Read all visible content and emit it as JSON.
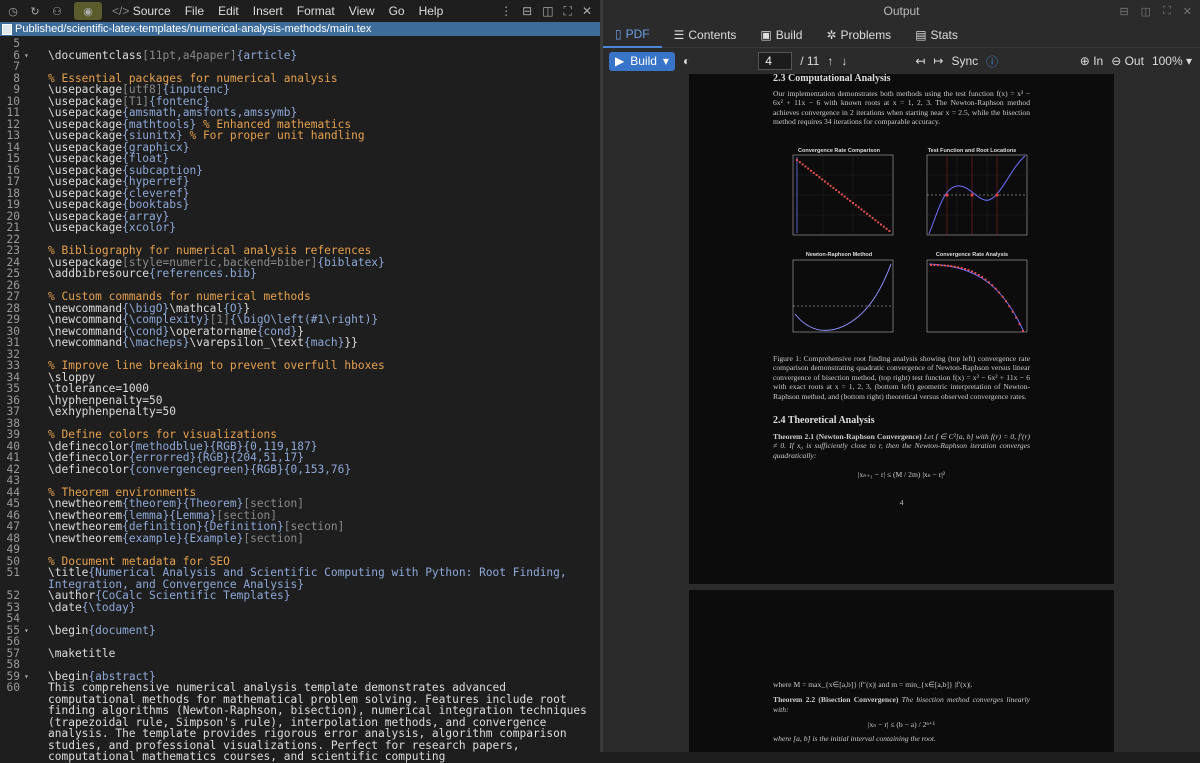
{
  "topbar": {
    "source_label": "Source",
    "menus": [
      "File",
      "Edit",
      "Insert",
      "Format",
      "View",
      "Go",
      "Help"
    ]
  },
  "path": "Published/scientific-latex-templates/numerical-analysis-methods/main.tex",
  "editor_lines": [
    {
      "n": "5",
      "f": "",
      "t": ""
    },
    {
      "n": "6",
      "f": "▾",
      "t": "\\documentclass[11pt,a4paper]{article}"
    },
    {
      "n": "7",
      "f": "",
      "t": ""
    },
    {
      "n": "8",
      "f": "",
      "t": "% Essential packages for numerical analysis"
    },
    {
      "n": "9",
      "f": "",
      "t": "\\usepackage[utf8]{inputenc}"
    },
    {
      "n": "10",
      "f": "",
      "t": "\\usepackage[T1]{fontenc}"
    },
    {
      "n": "11",
      "f": "",
      "t": "\\usepackage{amsmath,amsfonts,amssymb}"
    },
    {
      "n": "12",
      "f": "",
      "t": "\\usepackage{mathtools} % Enhanced mathematics"
    },
    {
      "n": "13",
      "f": "",
      "t": "\\usepackage{siunitx} % For proper unit handling"
    },
    {
      "n": "14",
      "f": "",
      "t": "\\usepackage{graphicx}"
    },
    {
      "n": "15",
      "f": "",
      "t": "\\usepackage{float}"
    },
    {
      "n": "16",
      "f": "",
      "t": "\\usepackage{subcaption}"
    },
    {
      "n": "17",
      "f": "",
      "t": "\\usepackage{hyperref}"
    },
    {
      "n": "18",
      "f": "",
      "t": "\\usepackage{cleveref}"
    },
    {
      "n": "19",
      "f": "",
      "t": "\\usepackage{booktabs}"
    },
    {
      "n": "20",
      "f": "",
      "t": "\\usepackage{array}"
    },
    {
      "n": "21",
      "f": "",
      "t": "\\usepackage{xcolor}"
    },
    {
      "n": "22",
      "f": "",
      "t": ""
    },
    {
      "n": "23",
      "f": "",
      "t": "% Bibliography for numerical analysis references"
    },
    {
      "n": "24",
      "f": "",
      "t": "\\usepackage[style=numeric,backend=biber]{biblatex}"
    },
    {
      "n": "25",
      "f": "",
      "t": "\\addbibresource{references.bib}"
    },
    {
      "n": "26",
      "f": "",
      "t": ""
    },
    {
      "n": "27",
      "f": "",
      "t": "% Custom commands for numerical methods"
    },
    {
      "n": "28",
      "f": "",
      "t": "\\newcommand{\\bigO}{\\mathcal{O}}"
    },
    {
      "n": "29",
      "f": "",
      "t": "\\newcommand{\\complexity}[1]{\\bigO\\left(#1\\right)}"
    },
    {
      "n": "30",
      "f": "",
      "t": "\\newcommand{\\cond}{\\operatorname{cond}}"
    },
    {
      "n": "31",
      "f": "",
      "t": "\\newcommand{\\macheps}{\\varepsilon_{\\text{mach}}}"
    },
    {
      "n": "32",
      "f": "",
      "t": ""
    },
    {
      "n": "33",
      "f": "",
      "t": "% Improve line breaking to prevent overfull hboxes"
    },
    {
      "n": "34",
      "f": "",
      "t": "\\sloppy"
    },
    {
      "n": "35",
      "f": "",
      "t": "\\tolerance=1000"
    },
    {
      "n": "36",
      "f": "",
      "t": "\\hyphenpenalty=50"
    },
    {
      "n": "37",
      "f": "",
      "t": "\\exhyphenpenalty=50"
    },
    {
      "n": "38",
      "f": "",
      "t": ""
    },
    {
      "n": "39",
      "f": "",
      "t": "% Define colors for visualizations"
    },
    {
      "n": "40",
      "f": "",
      "t": "\\definecolor{methodblue}{RGB}{0,119,187}"
    },
    {
      "n": "41",
      "f": "",
      "t": "\\definecolor{errorred}{RGB}{204,51,17}"
    },
    {
      "n": "42",
      "f": "",
      "t": "\\definecolor{convergencegreen}{RGB}{0,153,76}"
    },
    {
      "n": "43",
      "f": "",
      "t": ""
    },
    {
      "n": "44",
      "f": "",
      "t": "% Theorem environments"
    },
    {
      "n": "45",
      "f": "",
      "t": "\\newtheorem{theorem}{Theorem}[section]"
    },
    {
      "n": "46",
      "f": "",
      "t": "\\newtheorem{lemma}{Lemma}[section]"
    },
    {
      "n": "47",
      "f": "",
      "t": "\\newtheorem{definition}{Definition}[section]"
    },
    {
      "n": "48",
      "f": "",
      "t": "\\newtheorem{example}{Example}[section]"
    },
    {
      "n": "49",
      "f": "",
      "t": ""
    },
    {
      "n": "50",
      "f": "",
      "t": "% Document metadata for SEO"
    },
    {
      "n": "51",
      "f": "",
      "t": "\\title{Numerical Analysis and Scientific Computing with Python: Root Finding, Integration, and Convergence Analysis}"
    },
    {
      "n": "52",
      "f": "",
      "t": "\\author{CoCalc Scientific Templates}"
    },
    {
      "n": "53",
      "f": "",
      "t": "\\date{\\today}"
    },
    {
      "n": "54",
      "f": "",
      "t": ""
    },
    {
      "n": "55",
      "f": "▾",
      "t": "\\begin{document}"
    },
    {
      "n": "56",
      "f": "",
      "t": ""
    },
    {
      "n": "57",
      "f": "",
      "t": "\\maketitle"
    },
    {
      "n": "58",
      "f": "",
      "t": ""
    },
    {
      "n": "59",
      "f": "▾",
      "t": "\\begin{abstract}"
    },
    {
      "n": "60",
      "f": "",
      "t": "This comprehensive numerical analysis template demonstrates advanced computational methods for mathematical problem solving. Features include root finding algorithms (Newton-Raphson, bisection), numerical integration techniques (trapezoidal rule, Simpson's rule), interpolation methods, and convergence analysis. The template provides rigorous error analysis, algorithm comparison studies, and professional visualizations. Perfect for research papers, computational mathematics courses, and scientific computing"
    }
  ],
  "output": {
    "title": "Output",
    "tabs": [
      "PDF",
      "Contents",
      "Build",
      "Problems",
      "Stats"
    ],
    "build_label": "Build",
    "page_value": "4",
    "page_total": "/ 11",
    "sync_label": "Sync",
    "zoom_in": "In",
    "zoom_out": "Out",
    "zoom_value": "100%"
  },
  "pdf": {
    "section_23": "2.3    Computational Analysis",
    "para_23": "Our implementation demonstrates both methods using the test function f(x) = x³ − 6x² + 11x − 6 with known roots at x = 1, 2, 3. The Newton-Raphson method achieves convergence in 2 iterations when starting near x = 2.5, while the bisection method requires 34 iterations for comparable accuracy.",
    "plot_titles": [
      "Convergence Rate Comparison",
      "Test Function and Root Locations",
      "Newton-Raphson Method",
      "Convergence Rate Analysis"
    ],
    "caption": "Figure 1: Comprehensive root finding analysis showing (top left) convergence rate comparison demonstrating quadratic convergence of Newton-Raphson versus linear convergence of bisection method, (top right) test function f(x) = x³ − 6x² + 11x − 6 with exact roots at x = 1, 2, 3, (bottom left) geometric interpretation of Newton-Raphson method, and (bottom right) theoretical versus observed convergence rates.",
    "section_24": "2.4    Theoretical Analysis",
    "thm21_head": "Theorem 2.1 (Newton-Raphson Convergence)",
    "thm21_body": "Let f ∈ C²[a, b] with f(r) = 0, f′(r) ≠ 0. If x₀ is sufficiently close to r, then the Newton-Raphson iteration converges quadratically:",
    "eq21": "|xₙ₊₁ − r| ≤ (M / 2m) |xₙ − r|²",
    "page_num": "4",
    "p2_line": "where M = max_{x∈[a,b]} |f″(x)| and m = min_{x∈[a,b]} |f′(x)|.",
    "thm22_head": "Theorem 2.2 (Bisection Convergence)",
    "thm22_body": "The bisection method converges linearly with:",
    "eq22": "|xₙ − r| ≤ (b − a) / 2ⁿ⁺¹",
    "p2_last": "where [a, b] is the initial interval containing the root."
  }
}
